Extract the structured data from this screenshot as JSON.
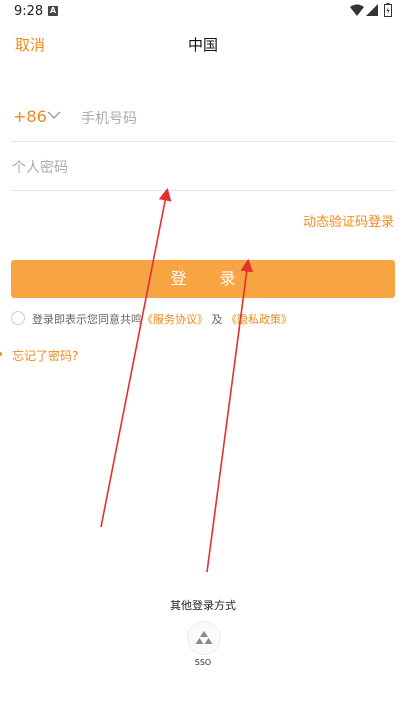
{
  "status_bar": {
    "time": "9:28",
    "notification_icon": "A"
  },
  "header": {
    "cancel_label": "取消",
    "title": "中国"
  },
  "form": {
    "country_code": "+86",
    "phone_placeholder": "手机号码",
    "password_placeholder": "个人密码",
    "sms_login_link": "动态验证码登录",
    "login_button": "登 录"
  },
  "agreement": {
    "prefix": "登录即表示您同意共鸣",
    "service": "《服务协议》",
    "and": "及",
    "privacy": "《隐私政策》"
  },
  "forgot_password": "忘记了密码?",
  "other_login": {
    "title": "其他登录方式",
    "sso_label": "SSO"
  },
  "colors": {
    "accent": "#f08a1c",
    "button": "#f7a443",
    "annotation": "#e53030"
  }
}
